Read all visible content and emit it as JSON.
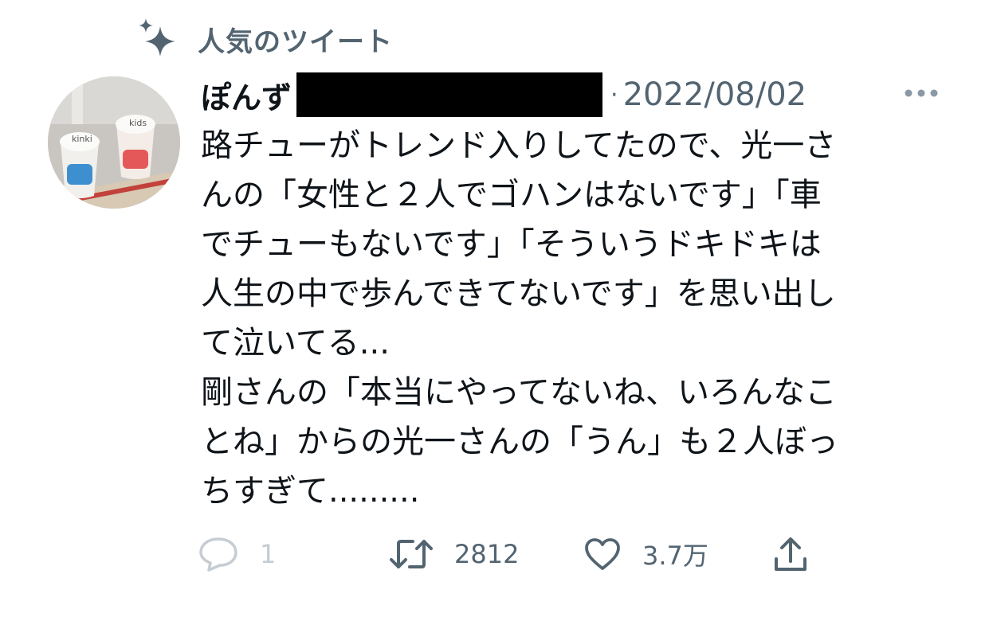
{
  "context": {
    "label": "人気のツイート",
    "icon": "sparkle-icon"
  },
  "tweet": {
    "author_name": "ぽんず",
    "separator": "·",
    "date": "2022/08/02",
    "more_icon": "more-icon",
    "avatar_cup_labels": [
      "kinki",
      "kids"
    ],
    "text_lines": [
      "路チューがトレンド入りしてたので、光一さ",
      "んの「女性と２人でゴハンはないです」「車",
      "でチューもないです」「そういうドキドキは",
      "人生の中で歩んできてないです」を思い出し",
      "て泣いてる...",
      "剛さんの「本当にやってないね、いろんなこ",
      "とね」からの光一さんの「うん」も２人ぼっ",
      "ちすぎて........."
    ]
  },
  "actions": {
    "reply": {
      "icon": "reply-icon",
      "count": "1"
    },
    "retweet": {
      "icon": "retweet-icon",
      "count": "2812"
    },
    "like": {
      "icon": "heart-icon",
      "count": "3.7万"
    },
    "share": {
      "icon": "share-icon"
    }
  },
  "colors": {
    "text": "#0f1419",
    "secondary": "#536471",
    "disabled": "#c5ccd3"
  }
}
